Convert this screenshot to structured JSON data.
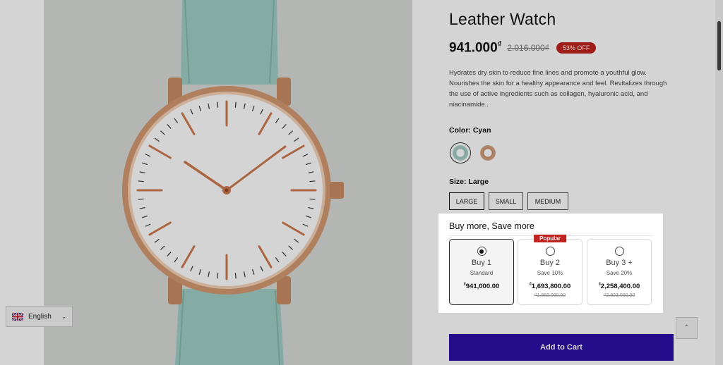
{
  "product": {
    "title": "Leather Watch",
    "price": "941.000",
    "currency": "₫",
    "old_price": "2.016.000₫",
    "discount": "53% OFF",
    "description": "Hydrates dry skin to reduce fine lines and promote a youthful glow. Nourishes the skin for a healthy appearance and feel. Revitalizes through the use of active ingredients such as collagen, hyaluronic acid, and niacinamide.."
  },
  "color": {
    "label": "Color:",
    "selected": "Cyan",
    "swatches": [
      {
        "name": "Cyan",
        "color": "#9fc9c3"
      },
      {
        "name": "Brown",
        "color": "#c98f6b"
      }
    ]
  },
  "size": {
    "label": "Size:",
    "selected": "Large",
    "options": [
      "LARGE",
      "SMALL",
      "MEDIUM"
    ]
  },
  "bundle": {
    "title": "Buy more, Save more",
    "options": [
      {
        "name": "Buy 1",
        "sub": "Standard",
        "currency": "₫",
        "price": "941,000.00",
        "old_price": "",
        "badge": "",
        "selected": true
      },
      {
        "name": "Buy 2",
        "sub": "Save 10%",
        "currency": "₫",
        "price": "1,693,800.00",
        "old_price": "₫1,882,000.00",
        "badge": "Popular",
        "selected": false
      },
      {
        "name": "Buy 3 +",
        "sub": "Save 20%",
        "currency": "₫",
        "price": "2,258,400.00",
        "old_price": "₫2,823,000.00",
        "badge": "",
        "selected": false
      }
    ]
  },
  "cart": {
    "label": "Add to Cart"
  },
  "language": {
    "label": "English",
    "icon": "uk-flag-icon"
  },
  "colors": {
    "accent": "#2d0fa8",
    "badge": "#c0221e"
  }
}
